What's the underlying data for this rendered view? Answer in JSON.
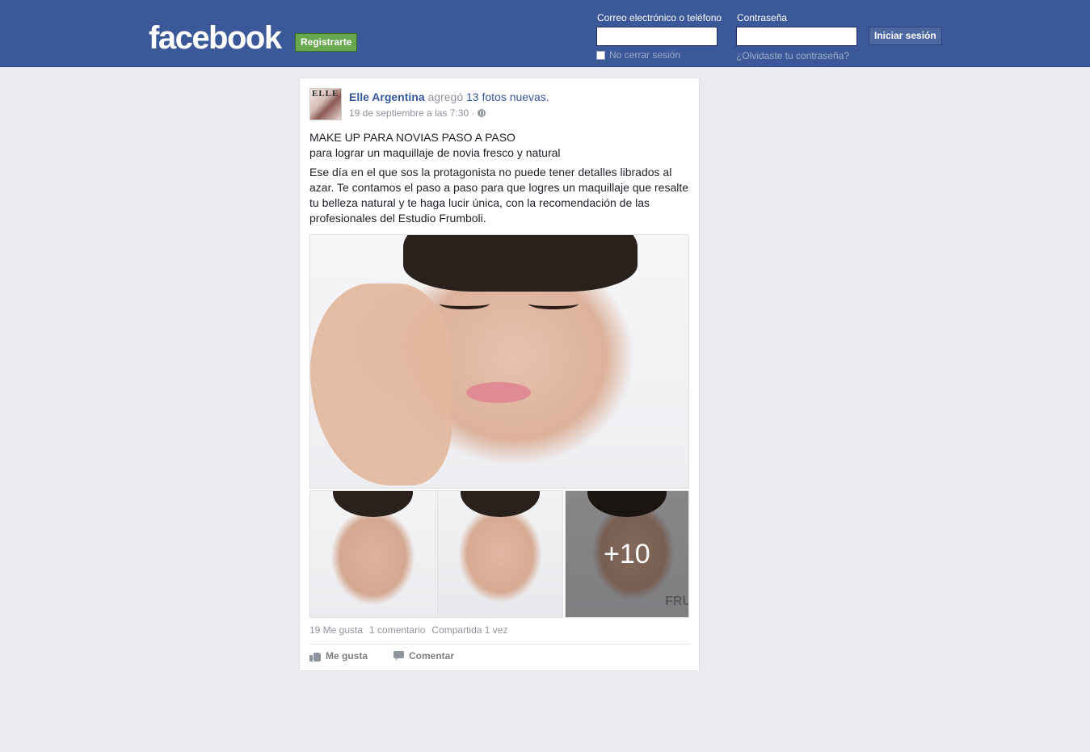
{
  "header": {
    "logo": "facebook",
    "signup_label": "Registrarte",
    "email_label": "Correo electrónico o teléfono",
    "password_label": "Contraseña",
    "login_label": "Iniciar sesión",
    "keep_logged_label": "No cerrar sesión",
    "forgot_label": "¿Olvidaste tu contraseña?"
  },
  "post": {
    "author": "Elle Argentina",
    "action": "agregó",
    "photos_link": "13 fotos nuevas.",
    "timestamp": "19 de septiembre a las 7:30 ·",
    "title_line1": "MAKE UP PARA NOVIAS PASO A PASO",
    "title_line2": "para lograr un maquillaje de novia fresco y natural",
    "body": "Ese día en el que sos la protagonista no puede tener detalles librados al azar. Te contamos el paso a paso para que logres un maquillaje que resalte tu belleza natural y te haga lucir única, con la recomendación de las profesionales del Estudio Frumboli.",
    "more_photos": "+10",
    "avatar_text": "ELLE",
    "watermark_text": "FRU",
    "stats": {
      "likes": "19 Me gusta",
      "comments": "1 comentario",
      "shares": "Compartida 1 vez"
    },
    "actions": {
      "like": "Me gusta",
      "comment": "Comentar"
    }
  },
  "colors": {
    "header_bg": "#3b5998",
    "signup_green": "#69a74e",
    "link_blue": "#365899"
  },
  "icons": [
    "globe-icon",
    "like-icon",
    "comment-icon"
  ]
}
